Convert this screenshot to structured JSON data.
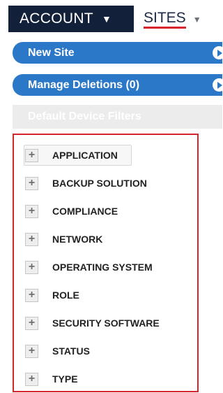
{
  "nav": {
    "account_label": "ACCOUNT",
    "sites_label": "SITES"
  },
  "actions": {
    "new_site": "New Site",
    "manage_deletions": "Manage Deletions (0)"
  },
  "filters": {
    "header": "Default Device Filters",
    "items": [
      {
        "label": "APPLICATION"
      },
      {
        "label": "BACKUP SOLUTION"
      },
      {
        "label": "COMPLIANCE"
      },
      {
        "label": "NETWORK"
      },
      {
        "label": "OPERATING SYSTEM"
      },
      {
        "label": "ROLE"
      },
      {
        "label": "SECURITY SOFTWARE"
      },
      {
        "label": "STATUS"
      },
      {
        "label": "TYPE"
      }
    ]
  },
  "colors": {
    "nav_dark": "#12203a",
    "accent_blue": "#2c78c8",
    "highlight_red": "#d8252c"
  }
}
